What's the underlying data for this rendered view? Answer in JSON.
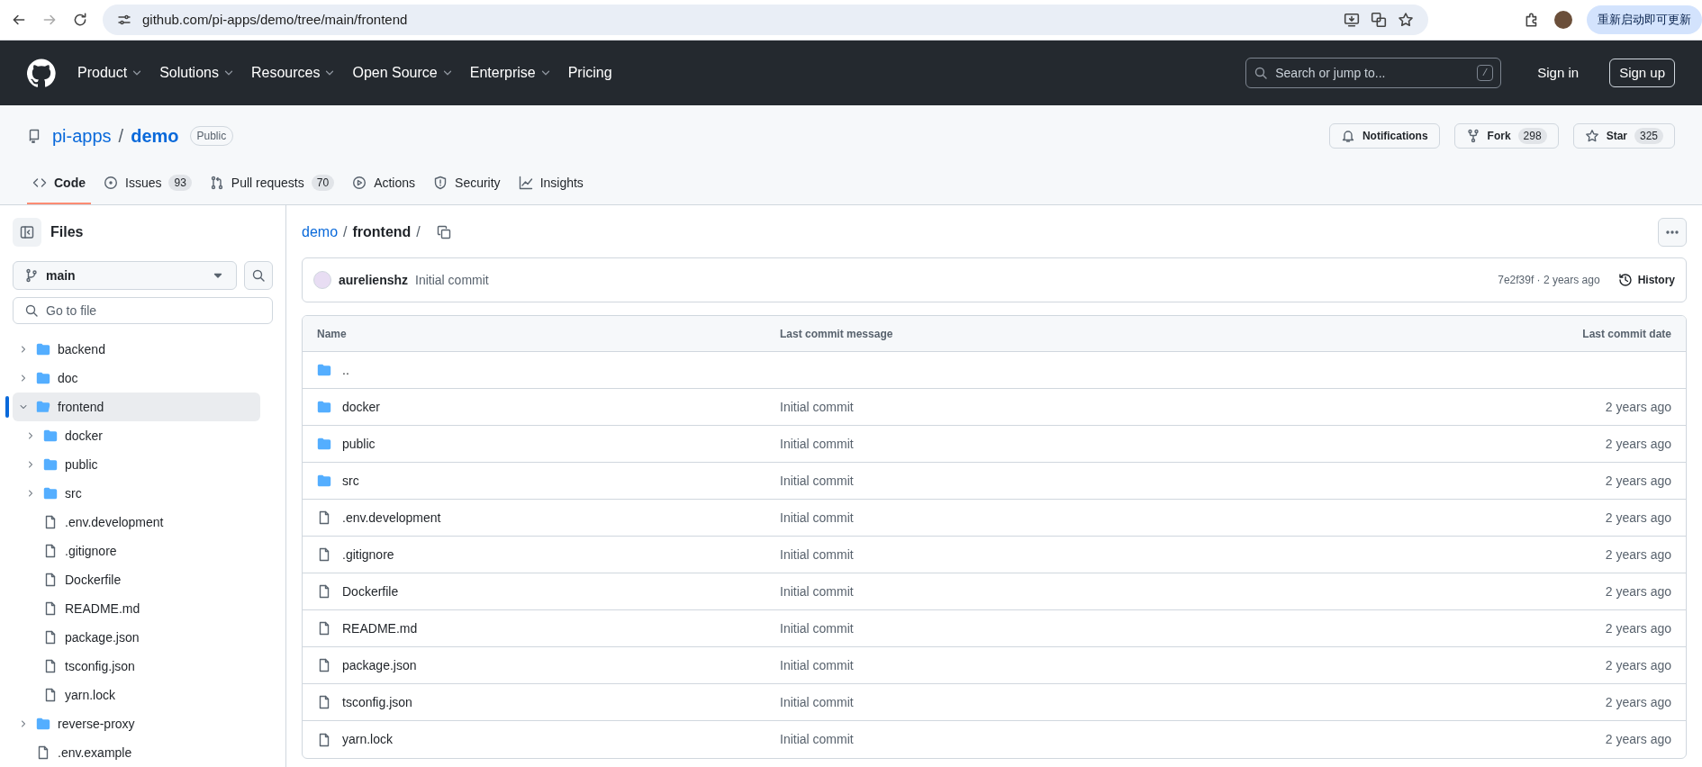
{
  "browser": {
    "url": "github.com/pi-apps/demo/tree/main/frontend",
    "update_button": "重新启动即可更新"
  },
  "header": {
    "nav": [
      {
        "label": "Product",
        "dropdown": true
      },
      {
        "label": "Solutions",
        "dropdown": true
      },
      {
        "label": "Resources",
        "dropdown": true
      },
      {
        "label": "Open Source",
        "dropdown": true
      },
      {
        "label": "Enterprise",
        "dropdown": true
      },
      {
        "label": "Pricing",
        "dropdown": false
      }
    ],
    "search_placeholder": "Search or jump to...",
    "search_key": "/",
    "sign_in": "Sign in",
    "sign_up": "Sign up"
  },
  "repo": {
    "owner": "pi-apps",
    "separator": "/",
    "name": "demo",
    "visibility": "Public",
    "notifications": "Notifications",
    "fork": {
      "label": "Fork",
      "count": "298"
    },
    "star": {
      "label": "Star",
      "count": "325"
    }
  },
  "tabs": [
    {
      "kind": "code",
      "label": "Code",
      "selected": true
    },
    {
      "kind": "issues",
      "label": "Issues",
      "count": "93",
      "selected": false
    },
    {
      "kind": "pulls",
      "label": "Pull requests",
      "count": "70",
      "selected": false
    },
    {
      "kind": "actions",
      "label": "Actions",
      "selected": false
    },
    {
      "kind": "security",
      "label": "Security",
      "selected": false
    },
    {
      "kind": "insights",
      "label": "Insights",
      "selected": false
    }
  ],
  "sidebar": {
    "title": "Files",
    "branch": "main",
    "search_placeholder": "Go to file",
    "tree": [
      {
        "kind": "folder",
        "name": "backend",
        "expanded": false,
        "selected": false
      },
      {
        "kind": "folder",
        "name": "doc",
        "expanded": false,
        "selected": false
      },
      {
        "kind": "folder",
        "name": "frontend",
        "expanded": true,
        "selected": true,
        "children": [
          {
            "kind": "folder",
            "name": "docker",
            "expanded": false,
            "selected": false
          },
          {
            "kind": "folder",
            "name": "public",
            "expanded": false,
            "selected": false
          },
          {
            "kind": "folder",
            "name": "src",
            "expanded": false,
            "selected": false
          },
          {
            "kind": "file",
            "name": ".env.development",
            "selected": false
          },
          {
            "kind": "file",
            "name": ".gitignore",
            "selected": false
          },
          {
            "kind": "file",
            "name": "Dockerfile",
            "selected": false
          },
          {
            "kind": "file",
            "name": "README.md",
            "selected": false
          },
          {
            "kind": "file",
            "name": "package.json",
            "selected": false
          },
          {
            "kind": "file",
            "name": "tsconfig.json",
            "selected": false
          },
          {
            "kind": "file",
            "name": "yarn.lock",
            "selected": false
          }
        ]
      },
      {
        "kind": "folder",
        "name": "reverse-proxy",
        "expanded": false,
        "selected": false
      },
      {
        "kind": "file",
        "name": ".env.example",
        "selected": false
      }
    ]
  },
  "breadcrumb": [
    {
      "kind": "link",
      "text": "demo"
    },
    {
      "kind": "separator",
      "text": "/"
    },
    {
      "kind": "current",
      "text": "frontend"
    },
    {
      "kind": "separator",
      "text": "/"
    }
  ],
  "commit": {
    "author": "aurelienshz",
    "message": "Initial commit",
    "hash_time": "7e2f39f · 2 years ago",
    "history": "History"
  },
  "table": {
    "columns": [
      "Name",
      "Last commit message",
      "Last commit date"
    ],
    "rows": [
      {
        "kind": "parent",
        "name": ".."
      },
      {
        "kind": "folder",
        "name": "docker",
        "message": "Initial commit",
        "date": "2 years ago"
      },
      {
        "kind": "folder",
        "name": "public",
        "message": "Initial commit",
        "date": "2 years ago"
      },
      {
        "kind": "folder",
        "name": "src",
        "message": "Initial commit",
        "date": "2 years ago"
      },
      {
        "kind": "file",
        "name": ".env.development",
        "message": "Initial commit",
        "date": "2 years ago"
      },
      {
        "kind": "file",
        "name": ".gitignore",
        "message": "Initial commit",
        "date": "2 years ago"
      },
      {
        "kind": "file",
        "name": "Dockerfile",
        "message": "Initial commit",
        "date": "2 years ago"
      },
      {
        "kind": "file",
        "name": "README.md",
        "message": "Initial commit",
        "date": "2 years ago"
      },
      {
        "kind": "file",
        "name": "package.json",
        "message": "Initial commit",
        "date": "2 years ago"
      },
      {
        "kind": "file",
        "name": "tsconfig.json",
        "message": "Initial commit",
        "date": "2 years ago"
      },
      {
        "kind": "file",
        "name": "yarn.lock",
        "message": "Initial commit",
        "date": "2 years ago"
      }
    ]
  }
}
